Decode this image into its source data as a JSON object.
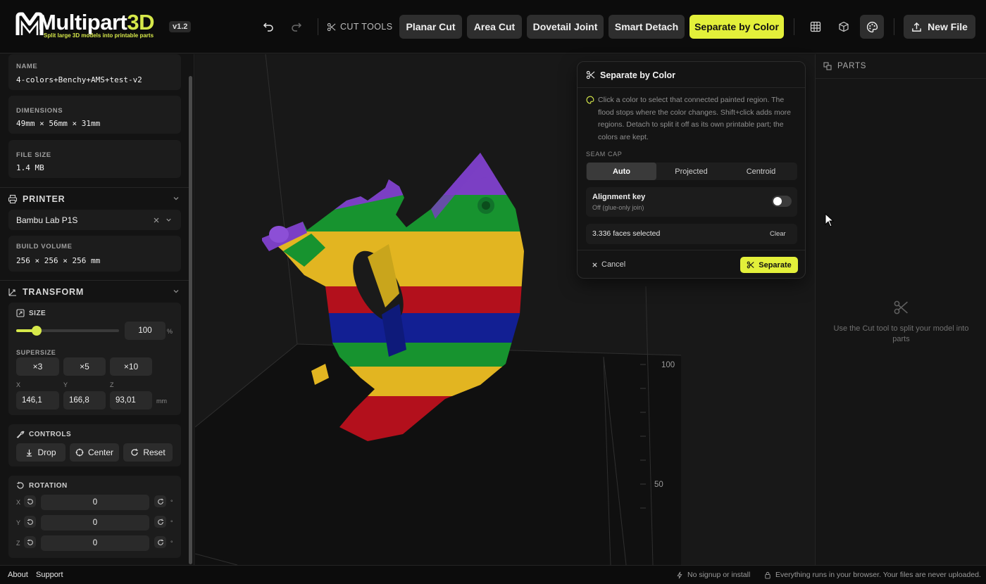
{
  "app": {
    "title_main": "Multipart",
    "title_accent": "3D",
    "subtitle": "Split large 3D models into printable parts",
    "version": "v1.2"
  },
  "toolbar": {
    "cut_tools_label": "CUT TOOLS",
    "tools": [
      "Planar Cut",
      "Area Cut",
      "Dovetail Joint",
      "Smart Detach",
      "Separate by Color"
    ],
    "active_tool": "Separate by Color",
    "new_file_label": "New File",
    "accent_color": "#e3f03a"
  },
  "sidebar": {
    "name_label": "NAME",
    "name_value": "4-colors+Benchy+AMS+test-v2",
    "dimensions_label": "DIMENSIONS",
    "dimensions_value": "49mm × 56mm × 31mm",
    "filesize_label": "FILE SIZE",
    "filesize_value": "1.4 MB",
    "printer": {
      "heading": "PRINTER",
      "selected": "Bambu Lab P1S",
      "build_volume_label": "BUILD VOLUME",
      "build_volume_value": "256 × 256 × 256 mm"
    },
    "transform": {
      "heading": "TRANSFORM",
      "size_label": "SIZE",
      "size_value": "100",
      "size_unit": "%",
      "size_slider_fraction": 0.2,
      "supersize_label": "SUPERSIZE",
      "supersize_options": [
        "×3",
        "×5",
        "×10"
      ],
      "axis_labels": [
        "X",
        "Y",
        "Z"
      ],
      "axis_values": [
        "146,1",
        "166,8",
        "93,01"
      ],
      "axis_unit": "mm"
    },
    "controls": {
      "heading": "CONTROLS",
      "drop": "Drop",
      "center": "Center",
      "reset": "Reset"
    },
    "rotation": {
      "heading": "ROTATION",
      "rows": [
        {
          "axis": "X",
          "value": "0",
          "unit": "°"
        },
        {
          "axis": "Y",
          "value": "0",
          "unit": "°"
        },
        {
          "axis": "Z",
          "value": "0",
          "unit": "°"
        }
      ]
    }
  },
  "viewport": {
    "axis_labels": [
      "100",
      "50"
    ]
  },
  "panel": {
    "title": "Separate by Color",
    "description": "Click a color to select that connected painted region. The flood stops where the color changes. Shift+click adds more regions. Detach to split it off as its own printable part; the colors are kept.",
    "seam_cap_label": "SEAM CAP",
    "seam_cap_options": [
      "Auto",
      "Projected",
      "Centroid"
    ],
    "seam_cap_selected": "Auto",
    "alignment_key_label": "Alignment key",
    "alignment_key_sub": "Off (glue-only join)",
    "alignment_key_on": false,
    "faces_selected": "3.336 faces selected",
    "clear_label": "Clear",
    "cancel_label": "Cancel",
    "separate_label": "Separate"
  },
  "parts": {
    "heading": "PARTS",
    "empty_text": "Use the Cut tool to split your model into parts"
  },
  "footer": {
    "about": "About",
    "support": "Support",
    "no_signup": "No signup or install",
    "privacy": "Everything runs in your browser. Your files are never uploaded."
  },
  "model_colors": {
    "purple": "#7b3fc4",
    "green": "#17932f",
    "yellow": "#e2b521",
    "red": "#b3101c",
    "blue": "#121f93"
  }
}
